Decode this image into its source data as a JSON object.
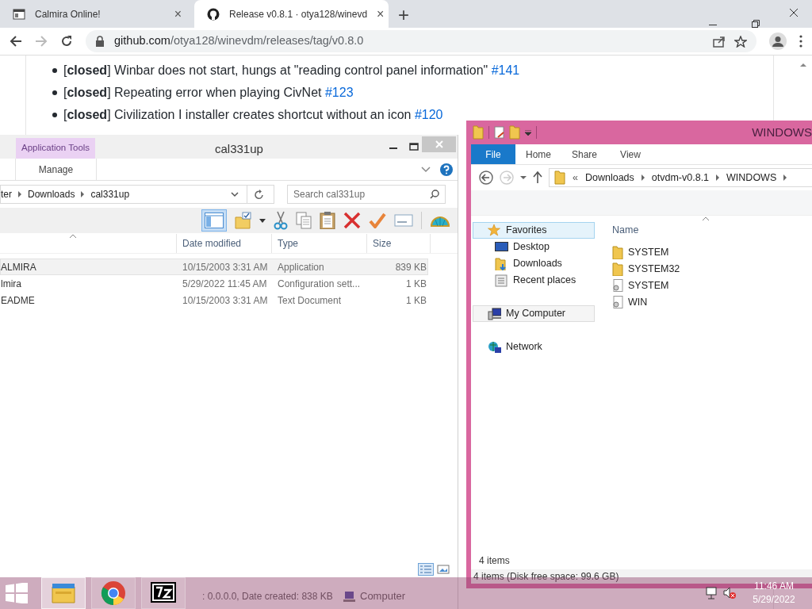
{
  "browser": {
    "tabs": [
      {
        "title": "Calmira Online!",
        "selected": false,
        "close": "×"
      },
      {
        "title": "Release v0.8.1 · otya128/winevd",
        "selected": true,
        "close": "×"
      }
    ],
    "new_tab": "+",
    "address": {
      "host": "github.com",
      "path": "/otya128/winevdm/releases/tag/v0.8.0"
    },
    "issues": [
      {
        "text": "[**closed**] Winbar does not start, hungs at \"reading control panel information\"",
        "link": "#141"
      },
      {
        "text": "[**closed**] Repeating error when playing CivNet",
        "link": "#123"
      },
      {
        "text": "[**closed**] Civilization I installer creates shortcut without an icon",
        "link": "#120"
      }
    ]
  },
  "left_window": {
    "context_tab": "Application Tools",
    "title": "cal331up",
    "ribbon_tabs": [
      "Manage"
    ],
    "breadcrumbs": [
      "ter",
      "Downloads",
      "cal331up"
    ],
    "search": {
      "placeholder": "Search cal331up"
    },
    "columns": [
      "Date modified",
      "Type",
      "Size"
    ],
    "rows": [
      {
        "name": "ALMIRA",
        "date": "10/15/2003 3:31 AM",
        "type": "Application",
        "size": "839 KB",
        "selected": true
      },
      {
        "name": "lmira",
        "date": "5/29/2022 11:45 AM",
        "type": "Configuration sett...",
        "size": "1 KB",
        "selected": false
      },
      {
        "name": "EADME",
        "date": "10/15/2003 3:31 AM",
        "type": "Text Document",
        "size": "1 KB",
        "selected": false
      }
    ],
    "status_fragments": [
      ": 0.0.0.0, Date created: 838 KB",
      "Computer"
    ]
  },
  "right_window": {
    "title": "WINDOWS",
    "ribbon_tabs": [
      {
        "label": "File",
        "selected": true
      },
      {
        "label": "Home",
        "selected": false
      },
      {
        "label": "Share",
        "selected": false
      },
      {
        "label": "View",
        "selected": false
      }
    ],
    "path_prefix": "«",
    "breadcrumbs": [
      "Downloads",
      "otvdm-v0.8.1",
      "WINDOWS"
    ],
    "nav": [
      {
        "label": "Favorites",
        "kind": "favorites",
        "selected": true,
        "hover": false,
        "children": [
          {
            "label": "Desktop",
            "kind": "desktop"
          },
          {
            "label": "Downloads",
            "kind": "downloads"
          },
          {
            "label": "Recent places",
            "kind": "recent"
          }
        ]
      },
      {
        "label": "My Computer",
        "kind": "computer",
        "selected": false,
        "hover": true
      },
      {
        "label": "Network",
        "kind": "network",
        "selected": false,
        "hover": false
      }
    ],
    "column": "Name",
    "files": [
      {
        "name": "SYSTEM",
        "kind": "folder"
      },
      {
        "name": "SYSTEM32",
        "kind": "folder"
      },
      {
        "name": "SYSTEM",
        "kind": "config"
      },
      {
        "name": "WIN",
        "kind": "config"
      }
    ],
    "item_count": "4 items",
    "status": "4 items (Disk free space: 99.6 GB)"
  },
  "taskbar": {
    "apps": [
      {
        "kind": "explorer",
        "selected": true
      },
      {
        "kind": "chrome",
        "selected": false
      },
      {
        "kind": "sevenzip",
        "selected": false
      }
    ],
    "clock": {
      "time": "11:46 AM",
      "date": "5/29/2022"
    }
  }
}
